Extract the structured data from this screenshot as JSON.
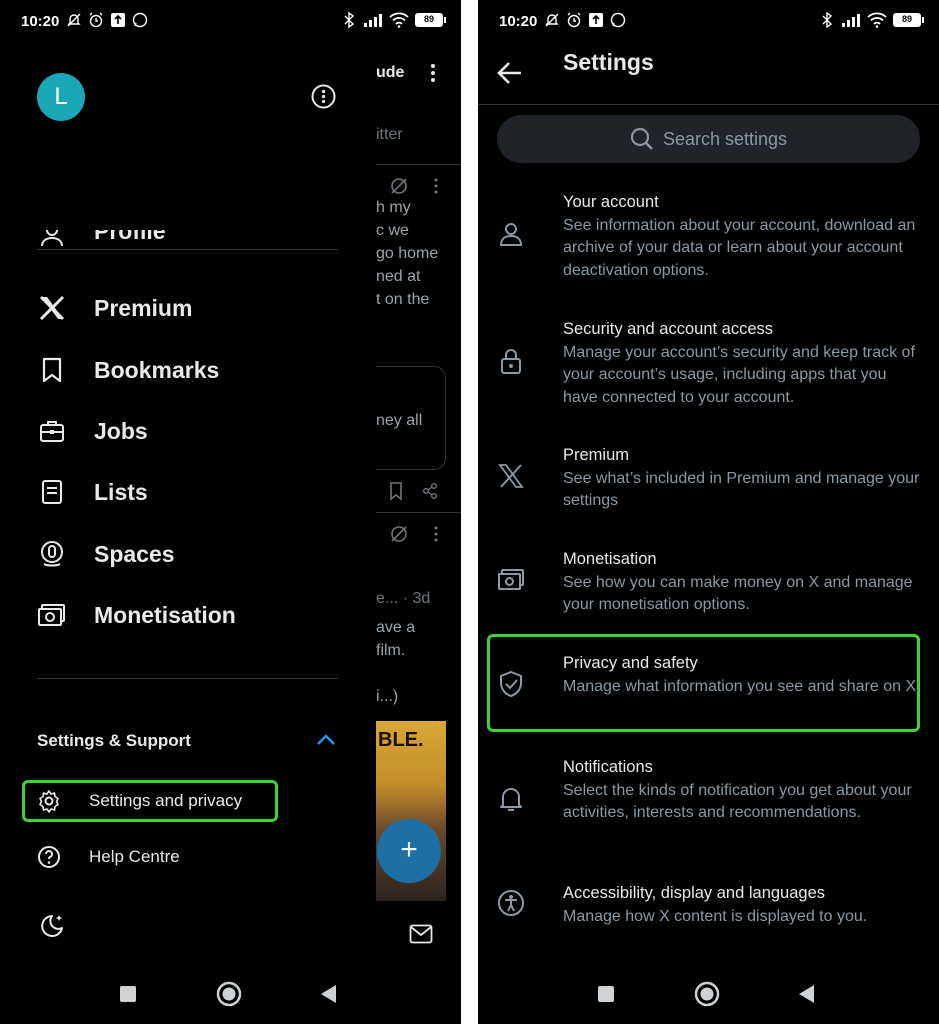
{
  "status_bar": {
    "time": "10:20",
    "battery": "89"
  },
  "left_screen": {
    "avatar_initial": "L",
    "background_timeline": {
      "fragments": [
        "ude",
        "itter",
        "h my",
        "c we",
        "go home",
        "ned at",
        "t on the",
        "ney all",
        "e... · 3d",
        "ave a",
        "film.",
        "i...)",
        "BLE."
      ]
    },
    "menu": [
      {
        "label": "Profile",
        "icon": "person-icon"
      },
      {
        "label": "Premium",
        "icon": "x-logo-icon"
      },
      {
        "label": "Bookmarks",
        "icon": "bookmark-icon"
      },
      {
        "label": "Jobs",
        "icon": "briefcase-icon"
      },
      {
        "label": "Lists",
        "icon": "list-icon"
      },
      {
        "label": "Spaces",
        "icon": "spaces-icon"
      },
      {
        "label": "Monetisation",
        "icon": "money-icon"
      }
    ],
    "settings_support": {
      "title": "Settings & Support",
      "items": [
        {
          "label": "Settings and privacy",
          "icon": "gear-icon",
          "highlighted": true
        },
        {
          "label": "Help Centre",
          "icon": "help-icon",
          "highlighted": false
        }
      ]
    },
    "fab_label": "+"
  },
  "right_screen": {
    "title": "Settings",
    "search_placeholder": "Search settings",
    "items": [
      {
        "title": "Your account",
        "description": "See information about your account, download an archive of your data or learn about your account deactivation options.",
        "icon": "person-icon",
        "highlighted": false
      },
      {
        "title": "Security and account access",
        "description": "Manage your account’s security and keep track of your account’s usage, including apps that you have connected to your account.",
        "icon": "lock-icon",
        "highlighted": false
      },
      {
        "title": "Premium",
        "description": "See what’s included in Premium and manage your settings",
        "icon": "x-logo-icon",
        "highlighted": false
      },
      {
        "title": "Monetisation",
        "description": "See how you can make money on X and manage your monetisation options.",
        "icon": "money-icon",
        "highlighted": false
      },
      {
        "title": "Privacy and safety",
        "description": "Manage what information you see and share on X.",
        "icon": "shield-icon",
        "highlighted": true
      },
      {
        "title": "Notifications",
        "description": "Select the kinds of notification you get about your activities, interests and recommendations.",
        "icon": "bell-icon",
        "highlighted": false
      },
      {
        "title": "Accessibility, display and languages",
        "description": "Manage how X content is displayed to you.",
        "icon": "accessibility-icon",
        "highlighted": false
      }
    ]
  },
  "colors": {
    "background": "#000000",
    "highlight_border": "#3fd13a",
    "accent_blue": "#1d9bf0",
    "avatar_teal": "#1aa7b6",
    "secondary_text": "#8b98a5"
  }
}
